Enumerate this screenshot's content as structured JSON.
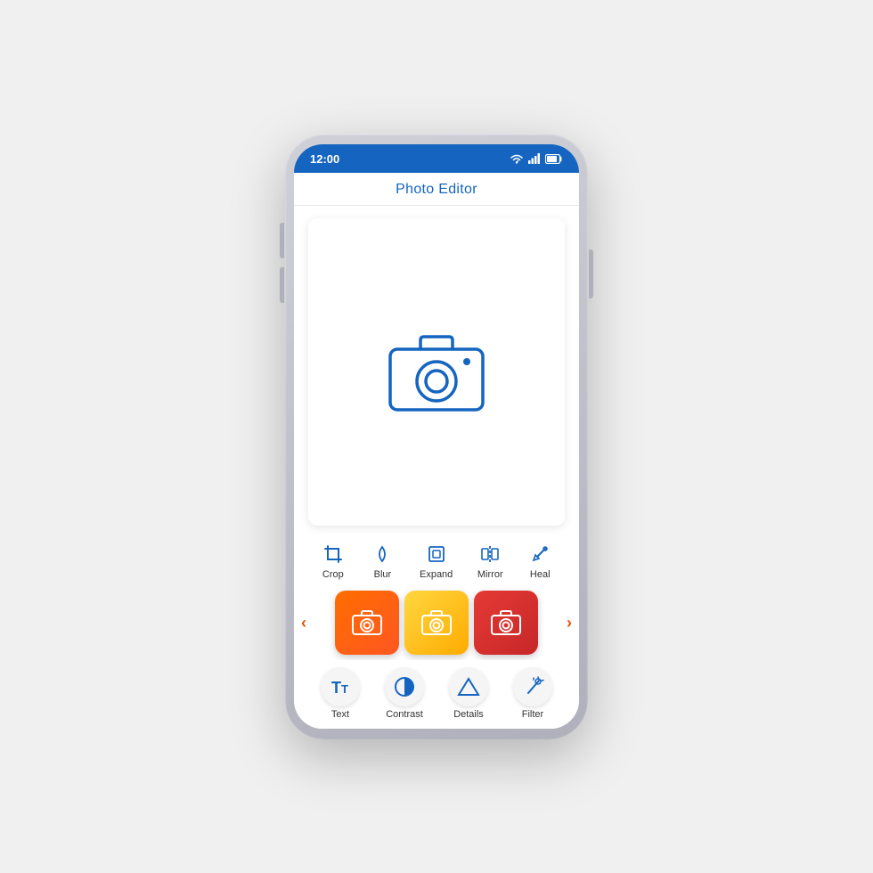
{
  "statusBar": {
    "time": "12:00",
    "wifiLabel": "wifi-icon",
    "signalLabel": "signal-icon",
    "batteryLabel": "battery-icon"
  },
  "header": {
    "title": "Photo Editor"
  },
  "tools": [
    {
      "id": "crop",
      "label": "Crop",
      "icon": "crop-icon"
    },
    {
      "id": "blur",
      "label": "Blur",
      "icon": "blur-icon"
    },
    {
      "id": "expand",
      "label": "Expand",
      "icon": "expand-icon"
    },
    {
      "id": "mirror",
      "label": "Mirror",
      "icon": "mirror-icon"
    },
    {
      "id": "heal",
      "label": "Heal",
      "icon": "heal-icon"
    }
  ],
  "filters": [
    {
      "id": "filter-orange",
      "color": "orange"
    },
    {
      "id": "filter-yellow",
      "color": "yellow"
    },
    {
      "id": "filter-red",
      "color": "red"
    }
  ],
  "filterArrows": {
    "left": "‹",
    "right": "›"
  },
  "bottomTools": [
    {
      "id": "text",
      "label": "Text",
      "icon": "text-icon"
    },
    {
      "id": "contrast",
      "label": "Contrast",
      "icon": "contrast-icon"
    },
    {
      "id": "details",
      "label": "Details",
      "icon": "details-icon"
    },
    {
      "id": "filter",
      "label": "Filter",
      "icon": "filter-icon"
    }
  ],
  "colors": {
    "accent": "#1565c0",
    "orange": "#ff5722",
    "yellow": "#ffab00",
    "red": "#c62828"
  }
}
